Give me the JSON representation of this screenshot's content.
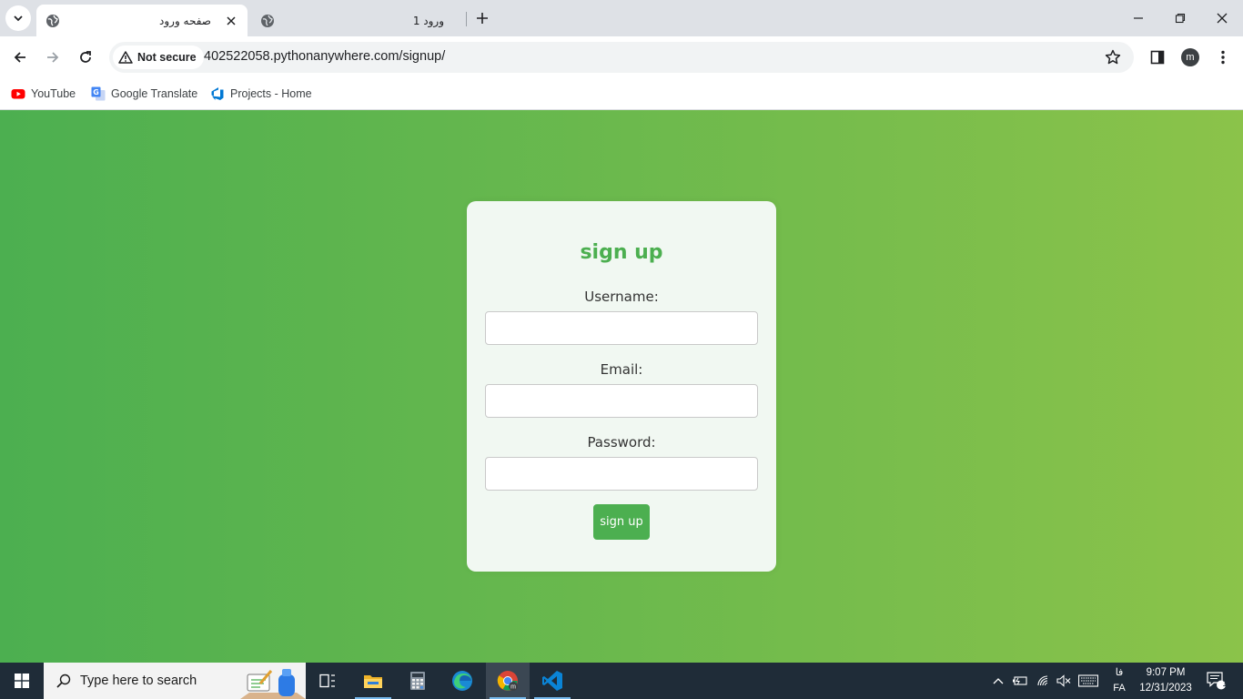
{
  "browser": {
    "tabs": [
      {
        "title": "صفحه ورود",
        "active": true
      },
      {
        "title": "ورود 1",
        "active": false
      }
    ],
    "security_chip": "Not secure",
    "url": "402522058.pythonanywhere.com/signup/",
    "profile_initial": "m",
    "bookmarks": [
      {
        "label": "YouTube",
        "icon": "youtube-icon"
      },
      {
        "label": "Google Translate",
        "icon": "google-translate-icon"
      },
      {
        "label": "Projects - Home",
        "icon": "azure-devops-icon"
      }
    ]
  },
  "page": {
    "heading": "sign up",
    "username_label": "Username:",
    "username_value": "",
    "email_label": "Email:",
    "email_value": "",
    "password_label": "Password:",
    "password_value": "",
    "submit_label": "sign up",
    "colors": {
      "gradient_start": "#4caf50",
      "gradient_end": "#8bc34a",
      "accent": "#4caf50",
      "card": "#f1f8f2"
    }
  },
  "taskbar": {
    "search_placeholder": "Type here to search",
    "apps": [
      "task-view-icon",
      "file-explorer-icon",
      "calculator-icon",
      "edge-icon",
      "chrome-icon",
      "vscode-icon"
    ],
    "language_line1": "فا",
    "language_line2": "FA",
    "time": "9:07 PM",
    "date": "12/31/2023",
    "notification_count": "1"
  }
}
